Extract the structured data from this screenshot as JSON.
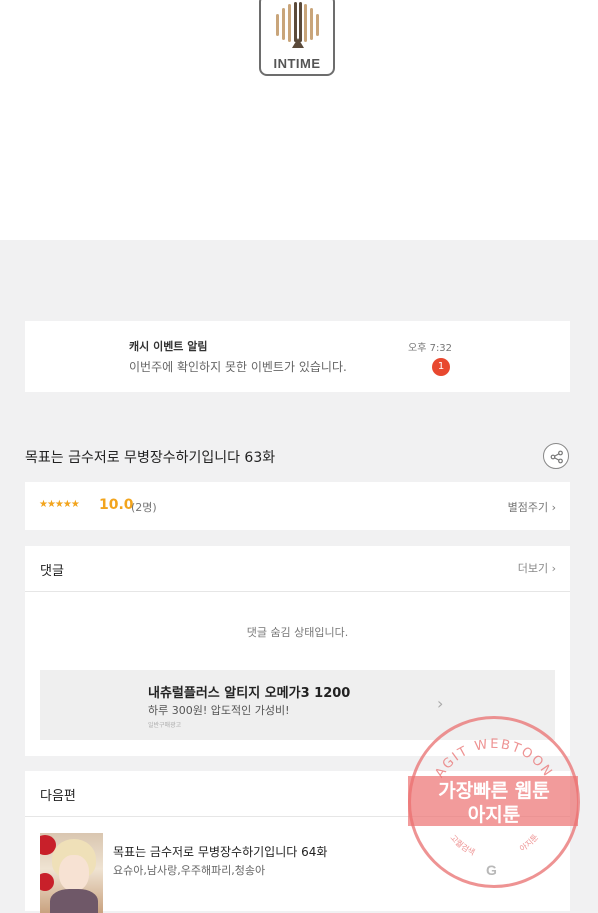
{
  "header": {
    "logo_text": "INTIME"
  },
  "notification": {
    "title": "캐시 이벤트 알림",
    "message": "이번주에 확인하지 못한 이벤트가 있습니다.",
    "time": "오후 7:32",
    "badge": "1"
  },
  "episode": {
    "title": "목표는 금수저로 무병장수하기입니다 63화"
  },
  "rating": {
    "stars": "★★★★★",
    "score": "10.0",
    "count": "(2명)",
    "rate_link": "별점주기 ›"
  },
  "comments": {
    "title": "댓글",
    "more": "더보기 ›",
    "hidden_message": "댓글 숨김 상태입니다.",
    "ad": {
      "title": "내츄럴플러스 알티지 오메가3 1200",
      "subtitle": "하루 300원! 압도적인 가성비!",
      "source": "일반구매광고",
      "arrow": "›"
    }
  },
  "next_episode": {
    "section_title": "다음편",
    "title": "목표는 금수저로 무병장수하기입니다 64화",
    "authors": "요슈아,남사랑,우주해파리,청송아"
  },
  "watermark": {
    "arc_text": "AGIT WEBTOON",
    "line1": "가장빠른 웹툰",
    "line2": "아지툰",
    "bottom_left": "고퀄검색",
    "bottom_right": "아지툰",
    "g_letter": "G"
  },
  "colors": {
    "accent_star": "#f2a41d",
    "badge": "#e8482f",
    "watermark": "#ec7070"
  }
}
